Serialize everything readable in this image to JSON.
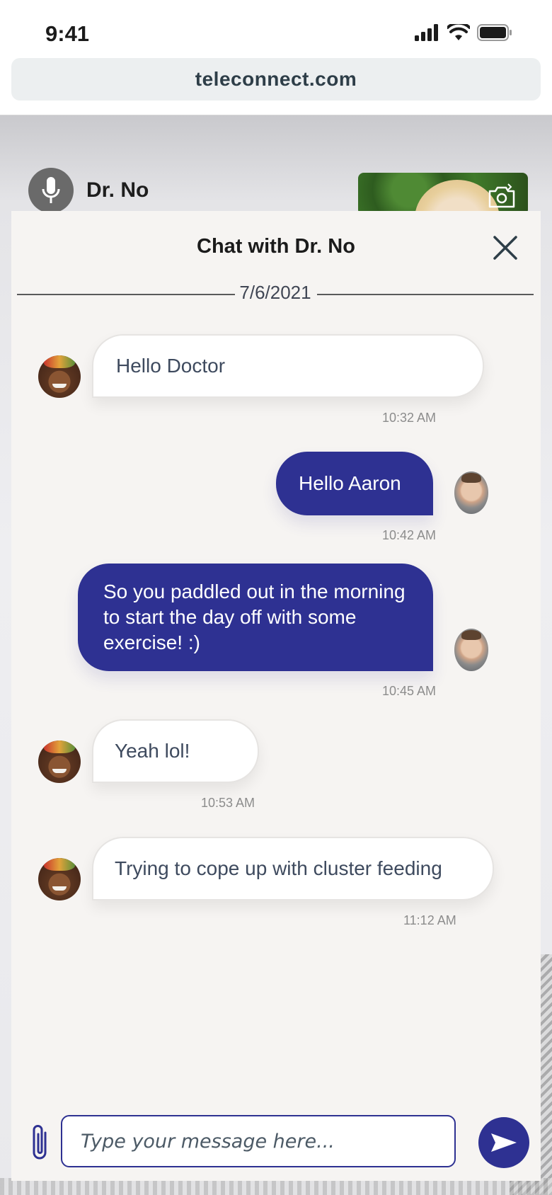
{
  "status_bar": {
    "time": "9:41"
  },
  "browser": {
    "url": "teleconnect.com"
  },
  "call": {
    "caller_name": "Dr. No"
  },
  "chat": {
    "title": "Chat with Dr. No",
    "date": "7/6/2021",
    "messages": [
      {
        "sender": "patient",
        "text": "Hello Doctor",
        "time": "10:32 AM"
      },
      {
        "sender": "doctor",
        "text": "Hello Aaron",
        "time": "10:42 AM"
      },
      {
        "sender": "doctor",
        "text": "So you paddled out in the morning to start the day off with some exercise! :)",
        "time": "10:45 AM"
      },
      {
        "sender": "patient",
        "text": "Yeah lol!",
        "time": "10:53 AM"
      },
      {
        "sender": "patient",
        "text": "Trying to cope up with cluster feeding",
        "time": "11:12 AM"
      }
    ],
    "input_placeholder": "Type your message here..."
  },
  "colors": {
    "accent": "#2e3192",
    "incoming_bubble": "#ffffff",
    "panel": "#f6f4f2"
  },
  "icons": [
    "signal-icon",
    "wifi-icon",
    "battery-icon",
    "microphone-icon",
    "camera-switch-icon",
    "close-icon",
    "paperclip-icon",
    "send-icon"
  ]
}
